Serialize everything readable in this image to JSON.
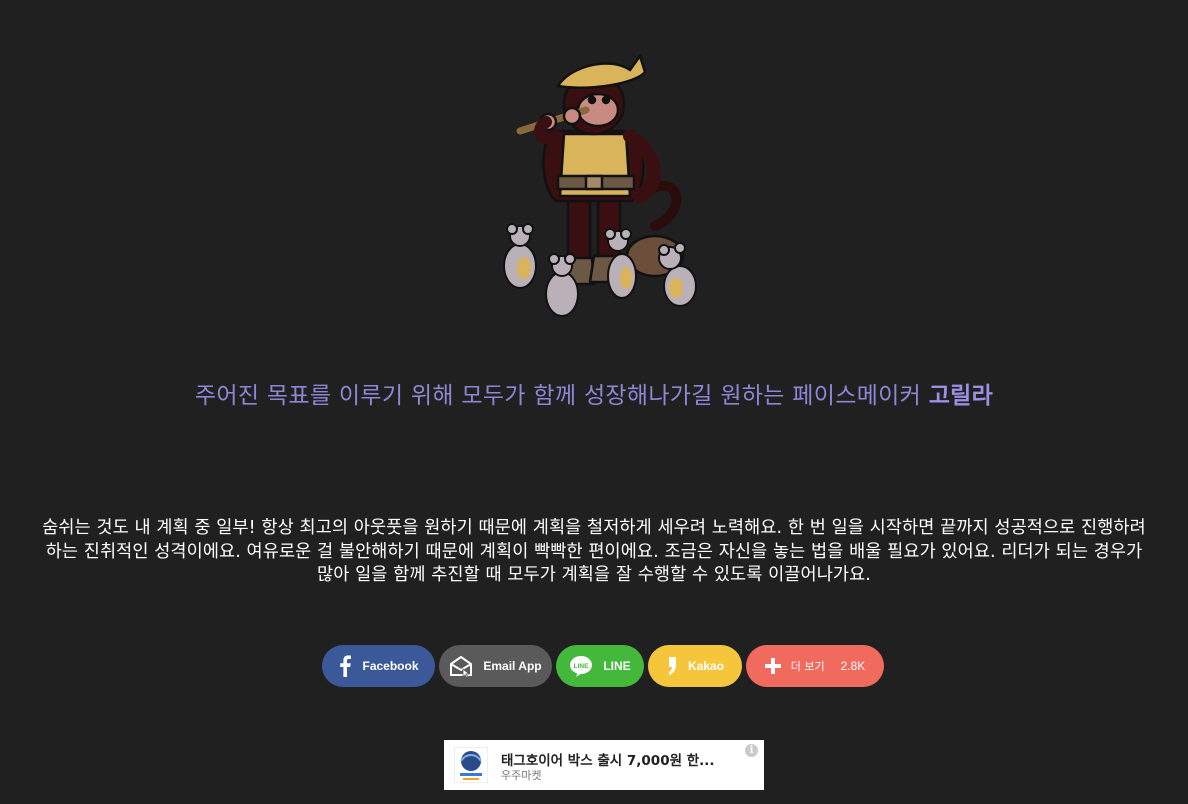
{
  "character": {
    "illustration_icon": "gorilla-pied-piper-with-mice"
  },
  "tagline": {
    "text": "주어진 목표를 이루기 위해 모두가 함께 성장해나가길 원하는 페이스메이커 ",
    "highlight": "고릴라",
    "color": "#8f86d6"
  },
  "description": {
    "text": "숨쉬는 것도 내 계획 중 일부! 항상 최고의 아웃풋을 원하기 때문에 계획을 철저하게 세우려 노력해요. 한 번 일을 시작하면 끝까지 성공적으로 진행하려하는 진취적인 성격이에요. 여유로운 걸 불안해하기 때문에 계획이 빡빡한 편이에요. 조금은 자신을 놓는 법을 배울 필요가 있어요. 리더가 되는 경우가 많아 일을 함께 추진할 때 모두가 계획을 잘 수행할 수 있도록 이끌어나가요."
  },
  "share": {
    "facebook": {
      "label": "Facebook",
      "icon": "facebook-icon",
      "color": "#3b5998"
    },
    "email": {
      "label": "Email App",
      "icon": "email-icon",
      "color": "#5a5a5a"
    },
    "line": {
      "label": "LINE",
      "icon": "line-icon",
      "color": "#44b83b"
    },
    "kakao": {
      "label": "Kakao",
      "icon": "kakao-icon",
      "color": "#f5c63b"
    },
    "more": {
      "label": "더 보기",
      "count": "2.8K",
      "icon": "plus-icon",
      "color": "#f06a5d"
    }
  },
  "ad": {
    "title": "태그호이어 박스 출시 7,000원 한...",
    "advertiser": "우주마켓",
    "info_icon": "info-icon"
  }
}
